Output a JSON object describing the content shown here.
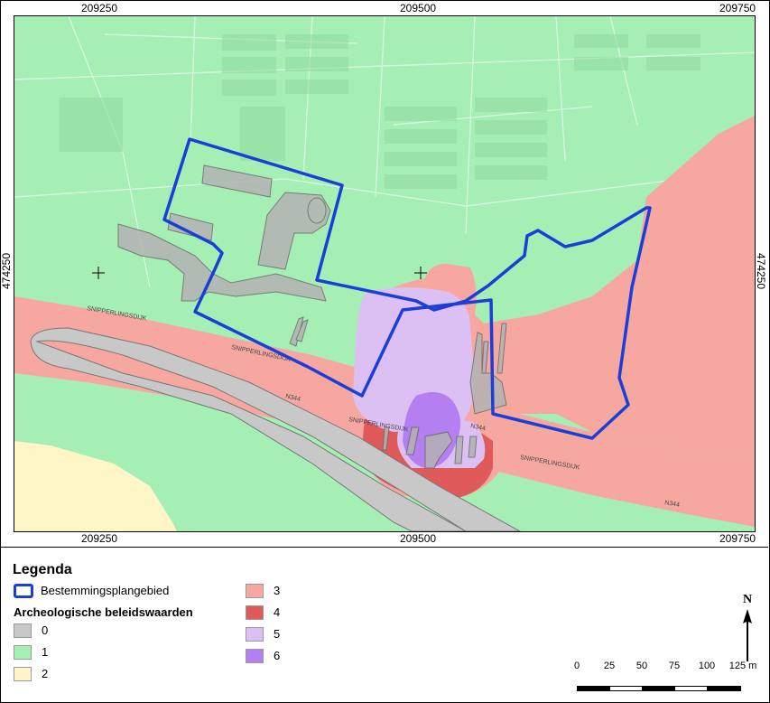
{
  "map": {
    "coords": {
      "top_left": "209250",
      "top_mid": "209500",
      "top_right": "209750",
      "bottom_left": "209250",
      "bottom_mid": "209500",
      "bottom_right": "209750",
      "left_mid": "474250",
      "right_mid": "474250"
    },
    "street_labels": {
      "s1": "SNIPPERLINGSDIJK",
      "s2": "SNIPPERLINGSDIJK",
      "s3": "SNIPPERLINGSDIJK",
      "s4": "SNIPPERLINGSDIJK",
      "s5": "N344",
      "s6": "N344",
      "s7": "N344"
    },
    "colors": {
      "value_0": "#c8c8c8",
      "value_1": "#a6efb4",
      "value_2": "#fff6c8",
      "value_3": "#f6a8a0",
      "value_4": "#e15a5a",
      "value_5": "#dcc0f4",
      "value_6": "#b47ff0",
      "boundary": "#1a3fd8"
    }
  },
  "legend": {
    "title": "Legenda",
    "boundary_label": "Bestemmingsplangebied",
    "values_header": "Archeologische beleidswaarden",
    "items": [
      {
        "label": "0"
      },
      {
        "label": "1"
      },
      {
        "label": "2"
      },
      {
        "label": "3"
      },
      {
        "label": "4"
      },
      {
        "label": "5"
      },
      {
        "label": "6"
      }
    ]
  },
  "scale": {
    "labels": [
      "0",
      "25",
      "50",
      "75",
      "100",
      "125 m"
    ]
  },
  "north": {
    "label": "N",
    "icon": "north-arrow-icon"
  }
}
